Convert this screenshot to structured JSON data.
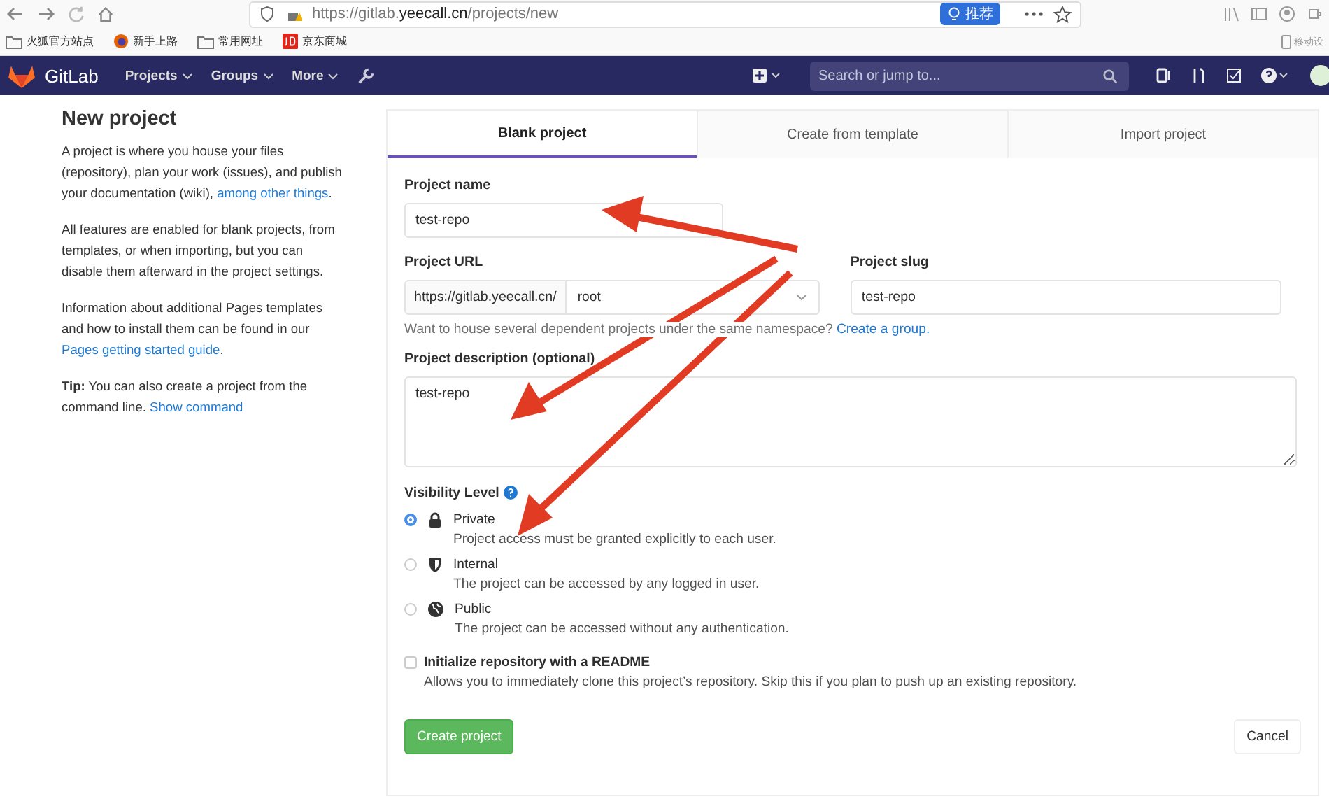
{
  "browser": {
    "url": "https://gitlab.**yeecall.cn**/projects/new",
    "recommend": "推荐",
    "bookmarks": [
      {
        "label": "火狐官方站点",
        "kind": "folder"
      },
      {
        "label": "新手上路",
        "kind": "firefox"
      },
      {
        "label": "常用网址",
        "kind": "folder"
      },
      {
        "label": "京东商城",
        "kind": "jd"
      }
    ],
    "mobile_bookmark": "移动设"
  },
  "navbar": {
    "brand": "GitLab",
    "menus": [
      "Projects",
      "Groups",
      "More"
    ],
    "search": {
      "placeholder": "Search or jump to..."
    }
  },
  "sidebar": {
    "title": "New project",
    "paragraphs": [
      {
        "text": "A project is where you house your files (repository), plan your work (issues), and publish your documentation (wiki), ",
        "link": "among other things",
        "after": "."
      },
      {
        "text": "All features are enabled for blank projects, from templates, or when importing, but you can disable them afterward in the project settings."
      },
      {
        "text": "Information about additional Pages templates and how to install them can be found in our ",
        "link": "Pages getting started guide",
        "after": "."
      },
      {
        "text": "**Tip:** You can also create a project from the command line. ",
        "link": "Show command"
      }
    ]
  },
  "tabs": [
    {
      "label": "Blank project",
      "selected": true
    },
    {
      "label": "Create from template",
      "selected": false
    },
    {
      "label": "Import project",
      "selected": false
    }
  ],
  "form": {
    "project_name": {
      "label": "Project name",
      "value": "test-repo"
    },
    "project_url": {
      "label": "Project URL",
      "prefix": "https://gitlab.yeecall.cn/",
      "namespace": "root"
    },
    "project_slug": {
      "label": "Project slug",
      "value": "test-repo"
    },
    "hint": {
      "text": "Want to house several dependent projects under the same namespace? ",
      "link": "Create a group."
    },
    "description": {
      "label": "Project description (optional)",
      "value": "test-repo"
    },
    "visibility": {
      "label": "Visibility Level",
      "options": [
        {
          "kind": "lock",
          "label": "Private",
          "description": "Project access must be granted explicitly to each user.",
          "selected": true
        },
        {
          "kind": "shield",
          "label": "Internal",
          "description": "The project can be accessed by any logged in user.",
          "selected": false
        },
        {
          "kind": "globe",
          "label": "Public",
          "description": "The project can be accessed without any authentication.",
          "selected": false
        }
      ]
    },
    "readme": {
      "label": "Initialize repository with a README",
      "description": "Allows you to immediately clone this project’s repository. Skip this if you plan to push up an existing repository.",
      "checked": false
    },
    "create_button": "Create project",
    "cancel_button": "Cancel"
  }
}
